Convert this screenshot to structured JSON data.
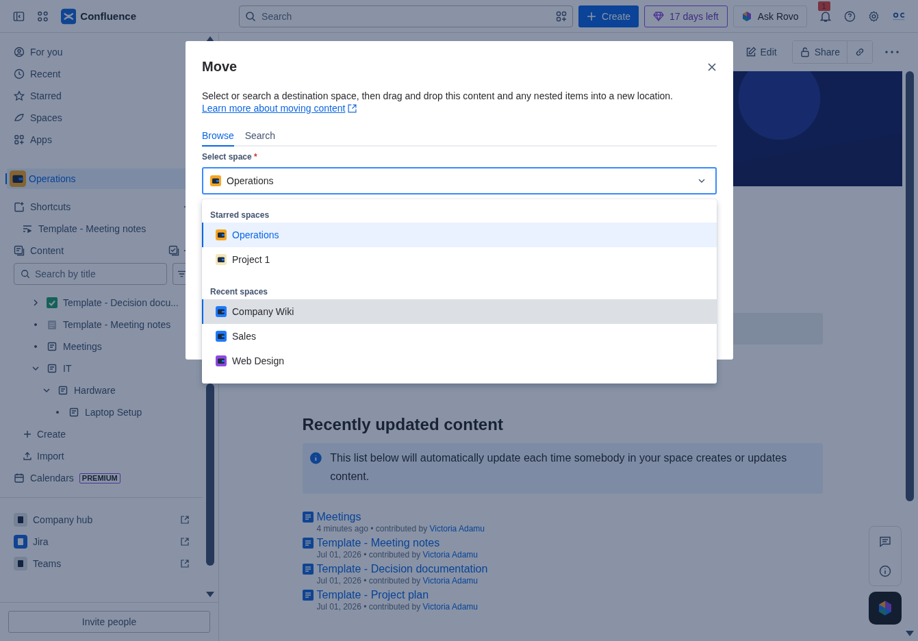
{
  "topbar": {
    "product": "Confluence",
    "search_placeholder": "Search",
    "create": "Create",
    "trial": "17 days left",
    "ask_rovo": "Ask Rovo",
    "notifications": "1"
  },
  "sidebar": {
    "nav": [
      "For you",
      "Recent",
      "Starred",
      "Spaces",
      "Apps"
    ],
    "space": {
      "name": "Operations",
      "selected": true
    },
    "shortcuts": {
      "label": "Shortcuts",
      "items": [
        "Template - Meeting notes"
      ]
    },
    "content": {
      "label": "Content",
      "search_placeholder": "Search by title",
      "tree": [
        {
          "title": "Template - Decision docu...",
          "kind": "decision",
          "expanded": false
        },
        {
          "title": "Template - Meeting notes",
          "kind": "notes"
        },
        {
          "title": "Meetings",
          "kind": "page"
        },
        {
          "title": "IT",
          "kind": "page",
          "expanded": true,
          "children": [
            {
              "title": "Hardware",
              "kind": "page",
              "expanded": true,
              "children": [
                {
                  "title": "Laptop Setup",
                  "kind": "page"
                }
              ]
            }
          ]
        }
      ]
    },
    "create": "Create",
    "import": "Import",
    "calendars": {
      "label": "Calendars",
      "badge": "PREMIUM"
    },
    "apps": [
      "Company hub",
      "Jira",
      "Teams"
    ],
    "invite": "Invite people"
  },
  "page_toolbar": {
    "edit": "Edit",
    "share": "Share"
  },
  "main": {
    "heading": "Recently updated content",
    "info": "This list below will automatically update each time somebody in your space creates or updates content.",
    "updates": [
      {
        "title": "Meetings",
        "meta": "4 minutes ago • contributed by",
        "author": "Victoria Adamu"
      },
      {
        "title": "Template - Meeting notes",
        "meta": "Jul 01, 2026 • contributed by",
        "author": "Victoria Adamu"
      },
      {
        "title": "Template - Decision documentation",
        "meta": "Jul 01, 2026 • contributed by",
        "author": "Victoria Adamu"
      },
      {
        "title": "Template - Project plan",
        "meta": "Jul 01, 2026 • contributed by",
        "author": "Victoria Adamu"
      }
    ]
  },
  "modal": {
    "title": "Move",
    "description": "Select or search a destination space, then drag and drop this content and any nested items into a new location.",
    "link": "Learn more about moving content",
    "tabs": [
      {
        "label": "Browse",
        "selected": true
      },
      {
        "label": "Search",
        "selected": false
      }
    ],
    "field_label": "Select space",
    "required_mark": "*",
    "value": "Operations",
    "groups": [
      {
        "heading": "Starred spaces",
        "items": [
          {
            "name": "Operations",
            "color": "#f5a623",
            "selected": true,
            "focused": false
          },
          {
            "name": "Project 1",
            "color": "#f3e6b5",
            "selected": false,
            "focused": false
          }
        ]
      },
      {
        "heading": "Recent spaces",
        "items": [
          {
            "name": "Company Wiki",
            "color": "#1d7afc",
            "selected": false,
            "focused": true
          },
          {
            "name": "Sales",
            "color": "#1d7afc",
            "selected": false,
            "focused": false
          },
          {
            "name": "Web Design",
            "color": "#8f49de",
            "selected": false,
            "focused": false
          }
        ]
      }
    ]
  }
}
